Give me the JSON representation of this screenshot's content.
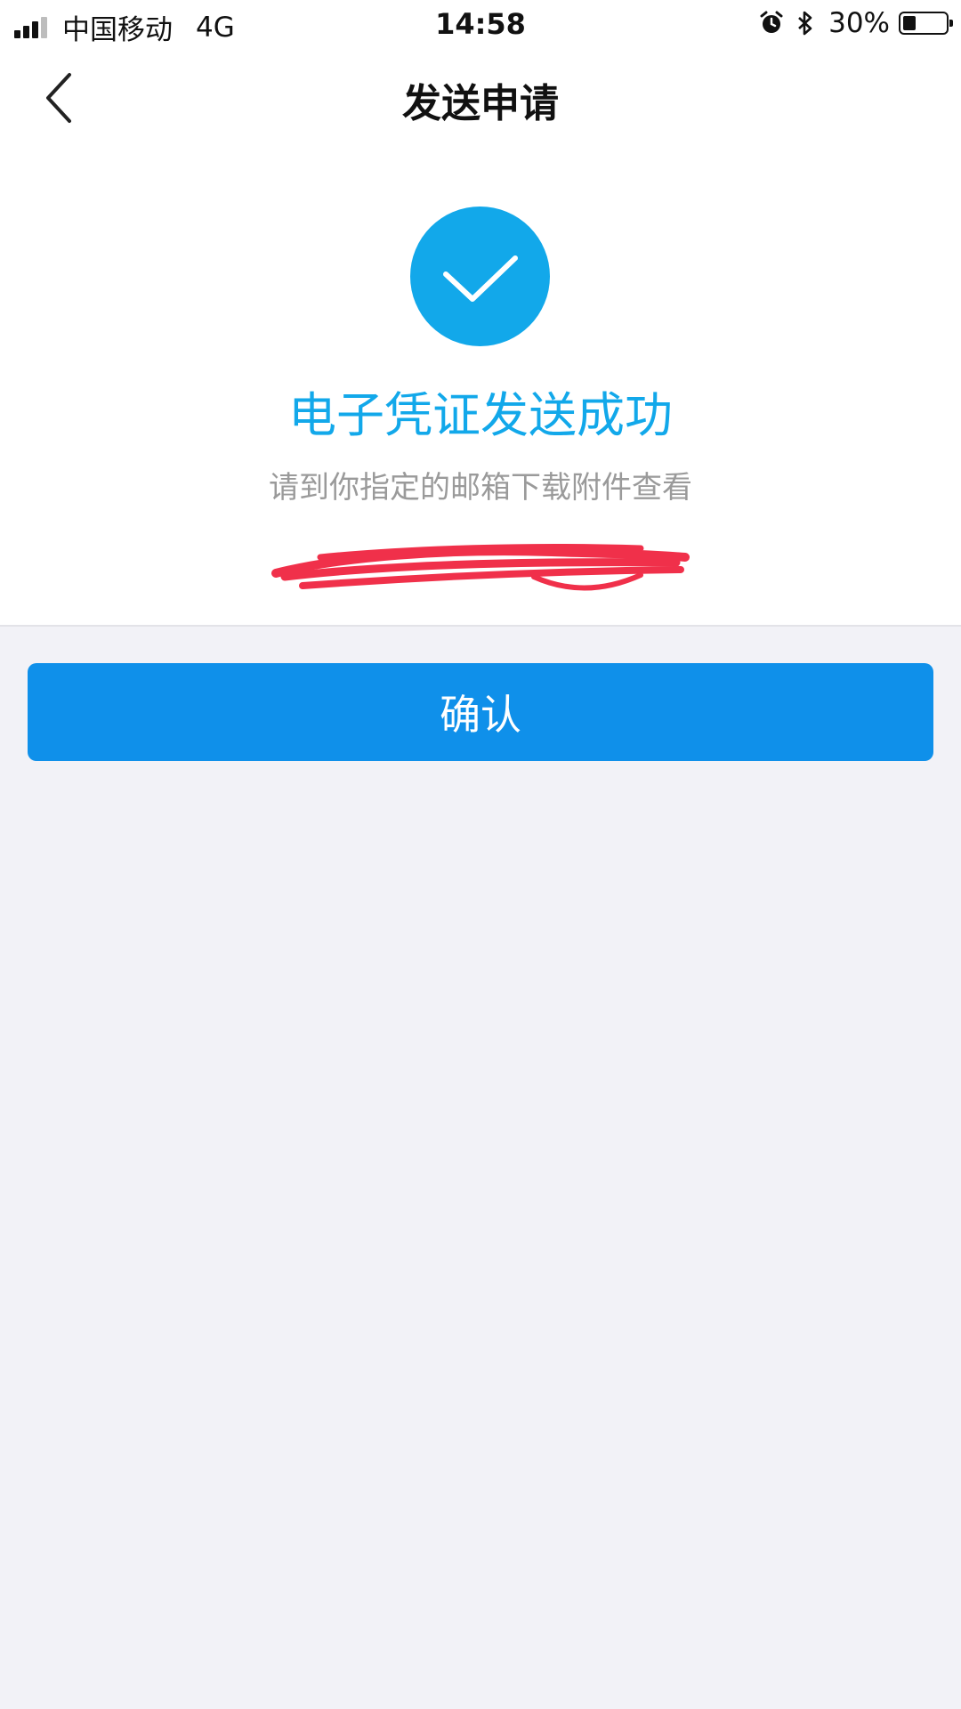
{
  "status_bar": {
    "carrier": "中国移动",
    "network": "4G",
    "time": "14:58",
    "battery_percent_label": "30%",
    "battery_level": 0.3,
    "signal_bars_active": 3,
    "signal_bars_total": 4,
    "icons": [
      "alarm-icon",
      "bluetooth-icon",
      "battery-icon"
    ]
  },
  "nav": {
    "title": "发送申请",
    "back_icon": "chevron-left-icon"
  },
  "result": {
    "icon": "checkmark-icon",
    "title": "电子凭证发送成功",
    "description": "请到你指定的邮箱下载附件查看"
  },
  "actions": {
    "confirm_label": "确认"
  },
  "colors": {
    "accent": "#12a8ea",
    "button": "#0f90ea",
    "page_background": "#f2f2f7",
    "redaction": "#f0304a"
  }
}
